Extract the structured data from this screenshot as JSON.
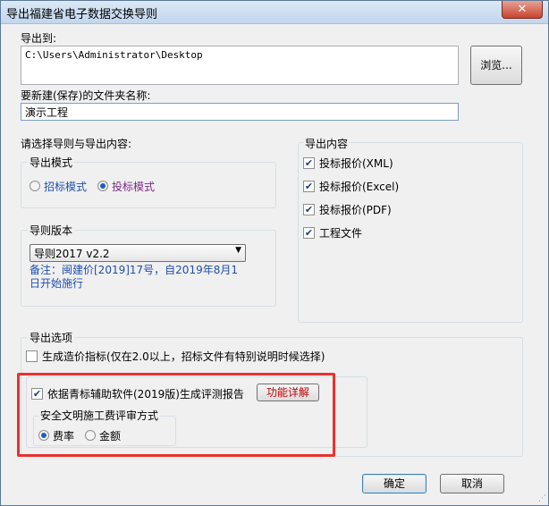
{
  "window": {
    "title": "导出福建省电子数据交换导则",
    "close_label": "✕"
  },
  "export_to": {
    "label": "导出到:",
    "path": "C:\\Users\\Administrator\\Desktop",
    "browse_label": "浏览..."
  },
  "folder": {
    "label": "要新建(保存)的文件夹名称:",
    "value": "演示工程"
  },
  "select_section_label": "请选择导则与导出内容:",
  "export_mode": {
    "title": "导出模式",
    "options": [
      {
        "label": "招标模式",
        "selected": false
      },
      {
        "label": "投标模式",
        "selected": true
      }
    ]
  },
  "guide_version": {
    "title": "导则版本",
    "selected": "导则2017 v2.2",
    "note": "备注：闽建价[2019]17号，自2019年8月1日开始施行"
  },
  "export_content": {
    "title": "导出内容",
    "items": [
      {
        "label": "投标报价(XML)",
        "checked": true
      },
      {
        "label": "投标报价(Excel)",
        "checked": true
      },
      {
        "label": "投标报价(PDF)",
        "checked": true
      },
      {
        "label": "工程文件",
        "checked": true
      }
    ]
  },
  "export_options": {
    "title": "导出选项",
    "cost_index": {
      "label": "生成造价指标(仅在2.0以上，招标文件有特别说明时候选择)",
      "checked": false
    },
    "eval_report": {
      "label": "依据青标辅助软件(2019版)生成评测报告",
      "checked": true
    },
    "func_detail_label": "功能详解",
    "safety": {
      "title": "安全文明施工费评审方式",
      "options": [
        {
          "label": "费率",
          "selected": true
        },
        {
          "label": "金额",
          "selected": false
        }
      ]
    }
  },
  "footer": {
    "ok_label": "确定",
    "cancel_label": "取消"
  },
  "colors": {
    "highlight_frame": "#e8322f",
    "link_text": "#1f4fb0"
  }
}
